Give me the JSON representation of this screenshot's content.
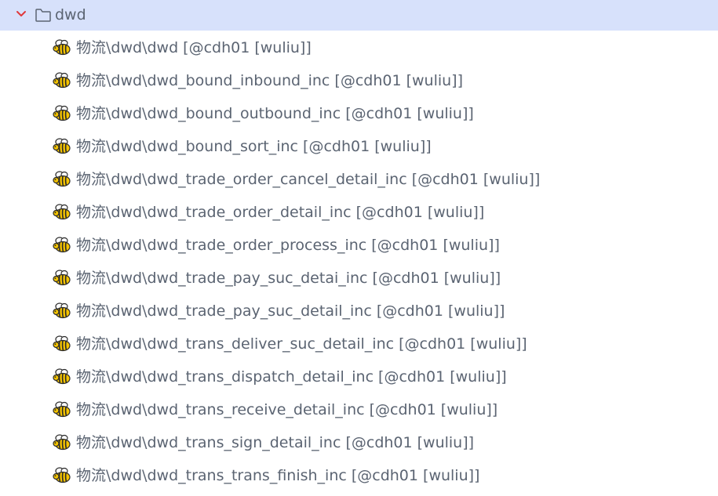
{
  "folder": {
    "label": "dwd",
    "expanded": true,
    "icon": "folder-icon",
    "chevron": "chevron-down-icon",
    "chevron_color": "#e0383b",
    "highlight_color": "#d7e1fb"
  },
  "items": [
    {
      "label": "物流\\dwd\\dwd [@cdh01 [wuliu]]",
      "icon": "hive-bee-icon"
    },
    {
      "label": "物流\\dwd\\dwd_bound_inbound_inc [@cdh01 [wuliu]]",
      "icon": "hive-bee-icon"
    },
    {
      "label": "物流\\dwd\\dwd_bound_outbound_inc [@cdh01 [wuliu]]",
      "icon": "hive-bee-icon"
    },
    {
      "label": "物流\\dwd\\dwd_bound_sort_inc [@cdh01 [wuliu]]",
      "icon": "hive-bee-icon"
    },
    {
      "label": "物流\\dwd\\dwd_trade_order_cancel_detail_inc [@cdh01 [wuliu]]",
      "icon": "hive-bee-icon"
    },
    {
      "label": "物流\\dwd\\dwd_trade_order_detail_inc [@cdh01 [wuliu]]",
      "icon": "hive-bee-icon"
    },
    {
      "label": "物流\\dwd\\dwd_trade_order_process_inc [@cdh01 [wuliu]]",
      "icon": "hive-bee-icon"
    },
    {
      "label": "物流\\dwd\\dwd_trade_pay_suc_detai_inc [@cdh01 [wuliu]]",
      "icon": "hive-bee-icon"
    },
    {
      "label": "物流\\dwd\\dwd_trade_pay_suc_detail_inc [@cdh01 [wuliu]]",
      "icon": "hive-bee-icon"
    },
    {
      "label": "物流\\dwd\\dwd_trans_deliver_suc_detail_inc [@cdh01 [wuliu]]",
      "icon": "hive-bee-icon"
    },
    {
      "label": "物流\\dwd\\dwd_trans_dispatch_detail_inc [@cdh01 [wuliu]]",
      "icon": "hive-bee-icon"
    },
    {
      "label": "物流\\dwd\\dwd_trans_receive_detail_inc [@cdh01 [wuliu]]",
      "icon": "hive-bee-icon"
    },
    {
      "label": "物流\\dwd\\dwd_trans_sign_detail_inc [@cdh01 [wuliu]]",
      "icon": "hive-bee-icon"
    },
    {
      "label": "物流\\dwd\\dwd_trans_trans_finish_inc [@cdh01 [wuliu]]",
      "icon": "hive-bee-icon"
    }
  ]
}
